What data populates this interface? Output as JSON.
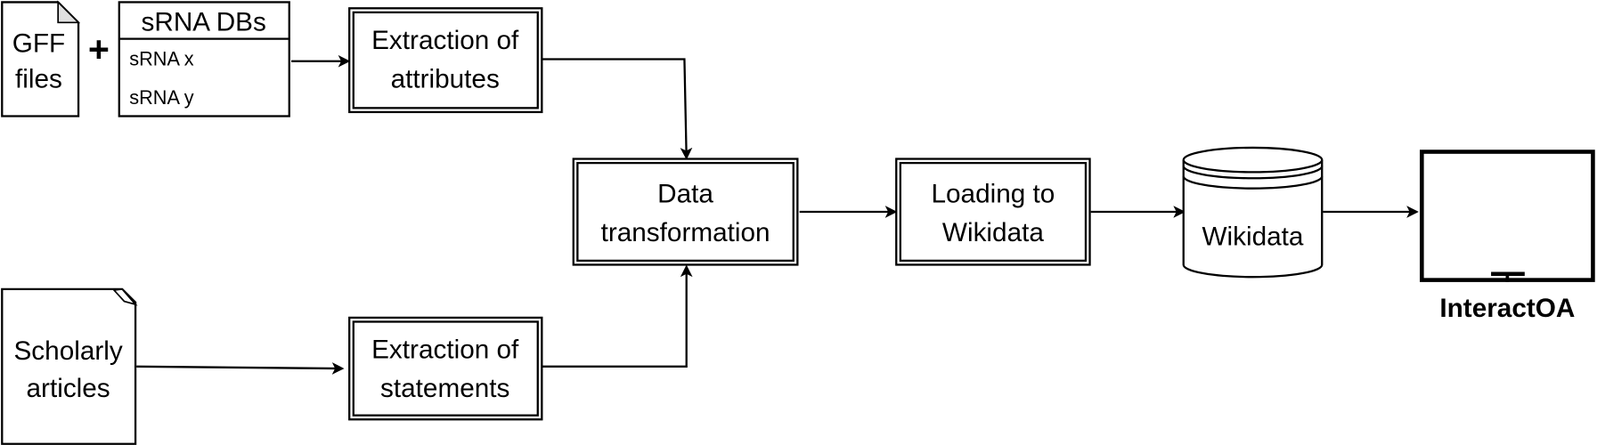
{
  "gff": {
    "line1": "GFF",
    "line2": "files"
  },
  "plus": "+",
  "srna_db": {
    "title": "sRNA DBs",
    "items": [
      "sRNA x",
      "sRNA y"
    ]
  },
  "extract_attributes": {
    "line1": "Extraction of",
    "line2": "attributes"
  },
  "scholarly": {
    "line1": "Scholarly",
    "line2": "articles"
  },
  "extract_statements": {
    "line1": "Extraction of",
    "line2": "statements"
  },
  "transform": {
    "line1": "Data",
    "line2": "transformation"
  },
  "loading": {
    "line1": "Loading to",
    "line2": "Wikidata"
  },
  "database": {
    "label": "Wikidata",
    "icon": "database-cylinder-icon"
  },
  "app": {
    "label": "InteractOA",
    "icon": "monitor-icon"
  },
  "colors": {
    "stroke": "#000000",
    "fold": "#e0e0e0"
  }
}
